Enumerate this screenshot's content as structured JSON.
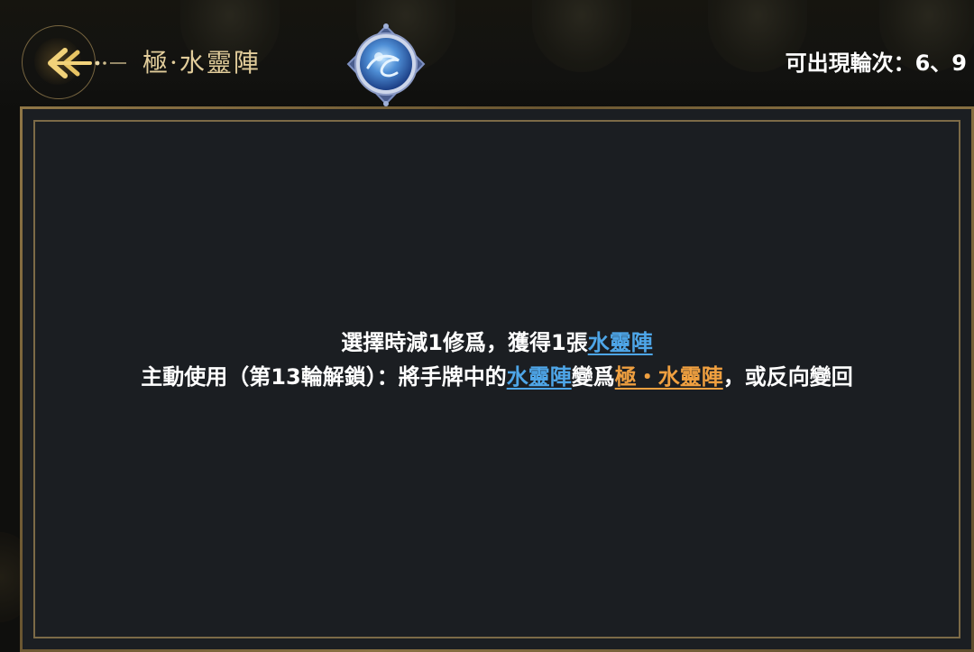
{
  "header": {
    "title": "極·水靈陣",
    "rounds_text": "可出現輪次：6、9",
    "back_icon": "back-arrow-icon",
    "card_icon": "water-spirit-array-icon"
  },
  "description": {
    "line1": {
      "text": "選擇時減1修爲，獲得1張",
      "link": "水靈陣"
    },
    "line2": {
      "text_a": "主動使用（第13輪解鎖）：將手牌中的",
      "link_a": "水靈陣",
      "text_b": "變爲",
      "link_b": "極・水靈陣",
      "text_c": "，或反向變回"
    }
  },
  "colors": {
    "link_blue": "#4ea6e8",
    "link_orange": "#f0a040",
    "title_gold": "#e2cd9b",
    "panel_bg": "#1b1e22",
    "frame_gold": "#7c6a47"
  }
}
